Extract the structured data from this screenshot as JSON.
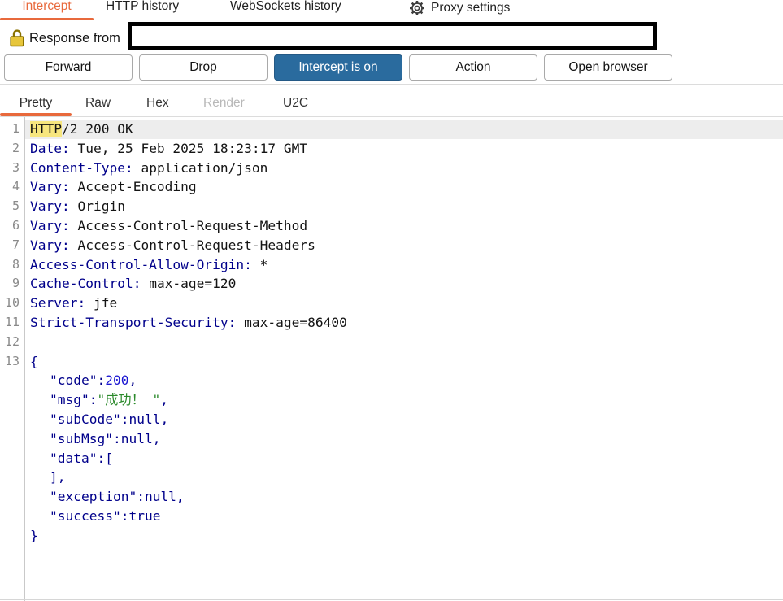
{
  "colors": {
    "accent_orange": "#E8693C",
    "intercept_on_blue": "#2A6B9E",
    "highlight_yellow": "#F7E67E",
    "selected_row_bg": "#EDEDED",
    "syntax_header_name": "#00008B",
    "syntax_number": "#1A16D1",
    "syntax_string": "#2C8A2C",
    "lock_gold": "#E7C63B"
  },
  "main_tabs": [
    {
      "label": "Intercept",
      "active": true
    },
    {
      "label": "HTTP history",
      "active": false
    },
    {
      "label": "WebSockets history",
      "active": false
    }
  ],
  "proxy_settings": {
    "label": "Proxy settings",
    "icon": "gear-icon"
  },
  "message_bar": {
    "label": "Response from",
    "icon": "lock-icon",
    "host_redacted": true
  },
  "toolbar": {
    "buttons": [
      {
        "label": "Forward",
        "style": "normal"
      },
      {
        "label": "Drop",
        "style": "normal"
      },
      {
        "label": "Intercept is on",
        "style": "primary"
      },
      {
        "label": "Action",
        "style": "normal"
      },
      {
        "label": "Open browser",
        "style": "normal"
      }
    ]
  },
  "editor_tabs": [
    {
      "label": "Pretty",
      "active": true,
      "disabled": false
    },
    {
      "label": "Raw",
      "active": false,
      "disabled": false
    },
    {
      "label": "Hex",
      "active": false,
      "disabled": false
    },
    {
      "label": "Render",
      "active": false,
      "disabled": true
    },
    {
      "label": "U2C",
      "active": false,
      "disabled": false
    }
  ],
  "editor": {
    "lines": [
      {
        "num": "1",
        "selected": true,
        "indent": 0,
        "segments": [
          {
            "text": "HTTP",
            "type": "hl"
          },
          {
            "text": "/2 200 OK",
            "type": "plain"
          }
        ]
      },
      {
        "num": "2",
        "indent": 0,
        "segments": [
          {
            "text": "Date:",
            "type": "name"
          },
          {
            "text": " Tue, 25 Feb 2025 18:23:17 GMT",
            "type": "plain"
          }
        ]
      },
      {
        "num": "3",
        "indent": 0,
        "segments": [
          {
            "text": "Content-Type:",
            "type": "name"
          },
          {
            "text": " application/json",
            "type": "plain"
          }
        ]
      },
      {
        "num": "4",
        "indent": 0,
        "segments": [
          {
            "text": "Vary:",
            "type": "name"
          },
          {
            "text": " Accept-Encoding",
            "type": "plain"
          }
        ]
      },
      {
        "num": "5",
        "indent": 0,
        "segments": [
          {
            "text": "Vary:",
            "type": "name"
          },
          {
            "text": " Origin",
            "type": "plain"
          }
        ]
      },
      {
        "num": "6",
        "indent": 0,
        "segments": [
          {
            "text": "Vary:",
            "type": "name"
          },
          {
            "text": " Access-Control-Request-Method",
            "type": "plain"
          }
        ]
      },
      {
        "num": "7",
        "indent": 0,
        "segments": [
          {
            "text": "Vary:",
            "type": "name"
          },
          {
            "text": " Access-Control-Request-Headers",
            "type": "plain"
          }
        ]
      },
      {
        "num": "8",
        "indent": 0,
        "segments": [
          {
            "text": "Access-Control-Allow-Origin:",
            "type": "name"
          },
          {
            "text": " *",
            "type": "plain"
          }
        ]
      },
      {
        "num": "9",
        "indent": 0,
        "segments": [
          {
            "text": "Cache-Control:",
            "type": "name"
          },
          {
            "text": " max-age=120",
            "type": "plain"
          }
        ]
      },
      {
        "num": "10",
        "indent": 0,
        "segments": [
          {
            "text": "Server:",
            "type": "name"
          },
          {
            "text": " jfe",
            "type": "plain"
          }
        ]
      },
      {
        "num": "11",
        "indent": 0,
        "segments": [
          {
            "text": "Strict-Transport-Security:",
            "type": "name"
          },
          {
            "text": " max-age=86400",
            "type": "plain"
          }
        ]
      },
      {
        "num": "12",
        "indent": 0,
        "segments": []
      },
      {
        "num": "13",
        "indent": 0,
        "segments": [
          {
            "text": "{",
            "type": "name"
          }
        ]
      },
      {
        "num": "",
        "indent": 1,
        "segments": [
          {
            "text": "\"code\":",
            "type": "name"
          },
          {
            "text": "200",
            "type": "num"
          },
          {
            "text": ",",
            "type": "name"
          }
        ]
      },
      {
        "num": "",
        "indent": 1,
        "segments": [
          {
            "text": "\"msg\":",
            "type": "name"
          },
          {
            "text": "\"成功！ \"",
            "type": "str"
          },
          {
            "text": ",",
            "type": "name"
          }
        ]
      },
      {
        "num": "",
        "indent": 1,
        "segments": [
          {
            "text": "\"subCode\":null,",
            "type": "name"
          }
        ]
      },
      {
        "num": "",
        "indent": 1,
        "segments": [
          {
            "text": "\"subMsg\":null,",
            "type": "name"
          }
        ]
      },
      {
        "num": "",
        "indent": 1,
        "segments": [
          {
            "text": "\"data\":[",
            "type": "name"
          }
        ]
      },
      {
        "num": "",
        "indent": 1,
        "segments": [
          {
            "text": "],",
            "type": "name"
          }
        ]
      },
      {
        "num": "",
        "indent": 1,
        "segments": [
          {
            "text": "\"exception\":null,",
            "type": "name"
          }
        ]
      },
      {
        "num": "",
        "indent": 1,
        "segments": [
          {
            "text": "\"success\":true",
            "type": "name"
          }
        ]
      },
      {
        "num": "",
        "indent": 0,
        "segments": [
          {
            "text": "}",
            "type": "name"
          }
        ]
      }
    ]
  }
}
